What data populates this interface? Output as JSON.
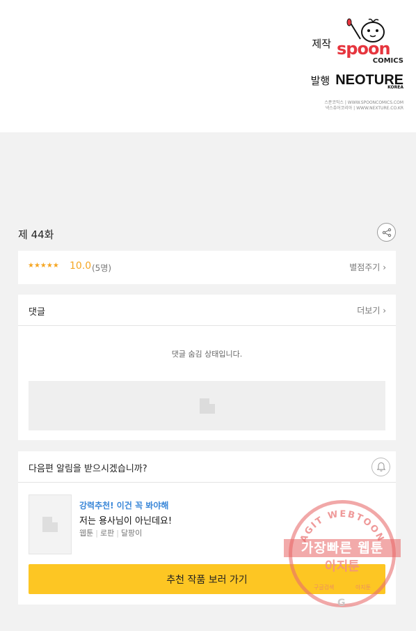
{
  "credits": {
    "maker_label": "제작",
    "maker_name": "spoon",
    "maker_sub": "COMICS",
    "publisher_label": "발행",
    "publisher_name": "NEOTURE",
    "publisher_sub": "KOREA",
    "footer_line1": "스푼코믹스 | WWW.SPOONCOMICS.COM",
    "footer_line2": "넥스츄어코리아 | WWW.NEXTURE.CO.KR"
  },
  "episode": {
    "title": "제 44화",
    "share_icon": "share-icon"
  },
  "rating": {
    "stars": "★★★★★",
    "score": "10.0",
    "votes": "(5명)",
    "rate_label": "별점주기",
    "star_color": "#f5a623"
  },
  "comments": {
    "title": "댓글",
    "more_label": "더보기",
    "hidden_message": "댓글 숨김 상태입니다."
  },
  "notify": {
    "question": "다음편 알림을 받으시겠습니까?",
    "bell_icon": "bell-icon",
    "recommendation": {
      "tag": "강력추천! 이건 꼭 봐야해",
      "title": "저는 용사님이 아닌데요!",
      "meta": [
        "웹툰",
        "로판",
        "달팡이"
      ],
      "tag_color": "#3a87d8"
    },
    "button_label": "추천 작품 보러 가기",
    "button_color": "#fdc623"
  },
  "watermark": {
    "arc_text": "AGIT WEBTOON",
    "line1": "가장빠른 웹툰",
    "line2": "아지툰",
    "bottom_left": "구글검색",
    "bottom_right": "아지툰",
    "g_letter": "G"
  }
}
